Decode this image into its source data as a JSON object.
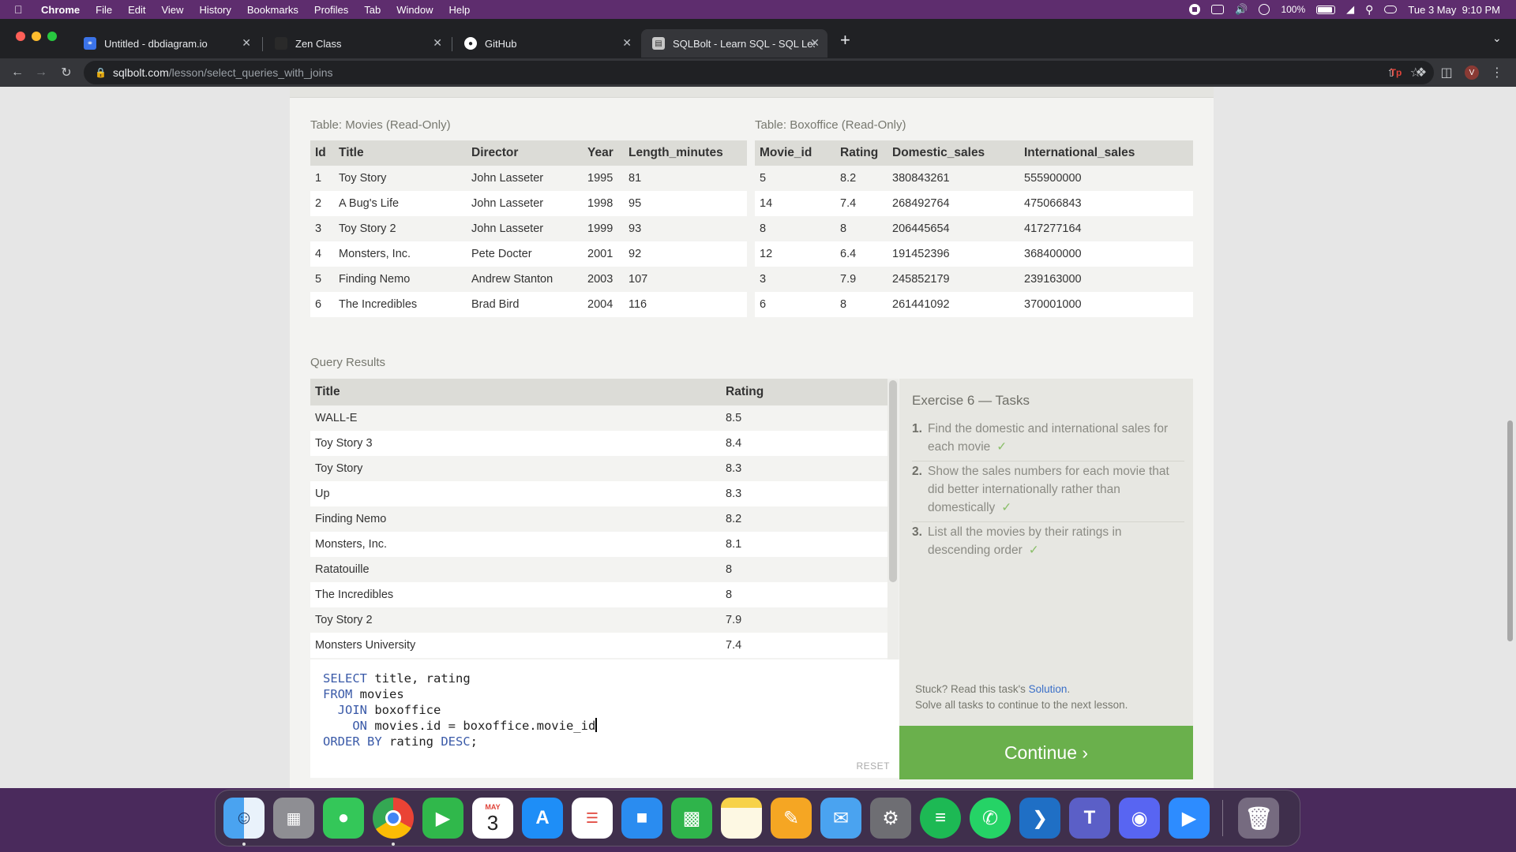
{
  "menubar": {
    "app": "Chrome",
    "items": [
      "File",
      "Edit",
      "View",
      "History",
      "Bookmarks",
      "Profiles",
      "Tab",
      "Window",
      "Help"
    ],
    "battery": "100%",
    "clock": "Tue 3 May  9:10 PM"
  },
  "tabs": [
    {
      "title": "Untitled - dbdiagram.io",
      "icon": "dbdiagram-icon"
    },
    {
      "title": "Zen Class",
      "icon": "zen-class-icon"
    },
    {
      "title": "GitHub",
      "icon": "github-icon"
    },
    {
      "title": "SQLBolt - Learn SQL - SQL Les",
      "icon": "sqlbolt-icon"
    }
  ],
  "url": {
    "host": "sqlbolt.com",
    "path": "/lesson/select_queries_with_joins"
  },
  "profile_initial": "V",
  "movies_table": {
    "caption": "Table: Movies (Read-Only)",
    "columns": [
      "Id",
      "Title",
      "Director",
      "Year",
      "Length_minutes"
    ],
    "rows": [
      [
        "1",
        "Toy Story",
        "John Lasseter",
        "1995",
        "81"
      ],
      [
        "2",
        "A Bug's Life",
        "John Lasseter",
        "1998",
        "95"
      ],
      [
        "3",
        "Toy Story 2",
        "John Lasseter",
        "1999",
        "93"
      ],
      [
        "4",
        "Monsters, Inc.",
        "Pete Docter",
        "2001",
        "92"
      ],
      [
        "5",
        "Finding Nemo",
        "Andrew Stanton",
        "2003",
        "107"
      ],
      [
        "6",
        "The Incredibles",
        "Brad Bird",
        "2004",
        "116"
      ]
    ]
  },
  "boxoffice_table": {
    "caption": "Table: Boxoffice (Read-Only)",
    "columns": [
      "Movie_id",
      "Rating",
      "Domestic_sales",
      "International_sales"
    ],
    "rows": [
      [
        "5",
        "8.2",
        "380843261",
        "555900000"
      ],
      [
        "14",
        "7.4",
        "268492764",
        "475066843"
      ],
      [
        "8",
        "8",
        "206445654",
        "417277164"
      ],
      [
        "12",
        "6.4",
        "191452396",
        "368400000"
      ],
      [
        "3",
        "7.9",
        "245852179",
        "239163000"
      ],
      [
        "6",
        "8",
        "261441092",
        "370001000"
      ]
    ]
  },
  "results": {
    "caption": "Query Results",
    "columns": [
      "Title",
      "Rating"
    ],
    "rows": [
      [
        "WALL-E",
        "8.5"
      ],
      [
        "Toy Story 3",
        "8.4"
      ],
      [
        "Toy Story",
        "8.3"
      ],
      [
        "Up",
        "8.3"
      ],
      [
        "Finding Nemo",
        "8.2"
      ],
      [
        "Monsters, Inc.",
        "8.1"
      ],
      [
        "Ratatouille",
        "8"
      ],
      [
        "The Incredibles",
        "8"
      ],
      [
        "Toy Story 2",
        "7.9"
      ],
      [
        "Monsters University",
        "7.4"
      ]
    ]
  },
  "editor": {
    "lines": [
      [
        {
          "k": "SELECT"
        },
        {
          "t": " title, rating"
        }
      ],
      [
        {
          "k": "FROM"
        },
        {
          "t": " movies"
        }
      ],
      [
        {
          "t": "  "
        },
        {
          "k": "JOIN"
        },
        {
          "t": " boxoffice"
        }
      ],
      [
        {
          "t": "    "
        },
        {
          "k": "ON"
        },
        {
          "t": " movies.id = boxoffice.movie_id"
        }
      ],
      [
        {
          "k": "ORDER BY"
        },
        {
          "t": " rating "
        },
        {
          "k": "DESC"
        },
        {
          "t": ";"
        }
      ]
    ],
    "reset_label": "RESET"
  },
  "exercise": {
    "title": "Exercise 6 — Tasks",
    "tasks": [
      {
        "num": "1.",
        "text": "Find the domestic and international sales for each movie",
        "done": "✓"
      },
      {
        "num": "2.",
        "text": "Show the sales numbers for each movie that did better internationally rather than domestically",
        "done": "✓"
      },
      {
        "num": "3.",
        "text": "List all the movies by their ratings in descending order",
        "done": "✓"
      }
    ],
    "stuck_prefix": "Stuck? Read this task's ",
    "solution_link": "Solution",
    "stuck_suffix": ".",
    "hint": "Solve all tasks to continue to the next lesson.",
    "continue_label": "Continue ›"
  },
  "dock": {
    "calendar_month": "MAY",
    "calendar_day": "3",
    "apps": [
      "finder-icon",
      "launchpad-icon",
      "messages-icon",
      "chrome-icon",
      "facetime-icon",
      "calendar-icon",
      "app-store-icon",
      "reminders-icon",
      "keynote-icon",
      "numbers-icon",
      "notes-icon",
      "pages-icon",
      "mail-icon",
      "system-preferences-icon",
      "spotify-icon",
      "whatsapp-icon",
      "vscode-icon",
      "teams-icon",
      "discord-icon",
      "zoom-icon",
      "trash-icon"
    ]
  }
}
